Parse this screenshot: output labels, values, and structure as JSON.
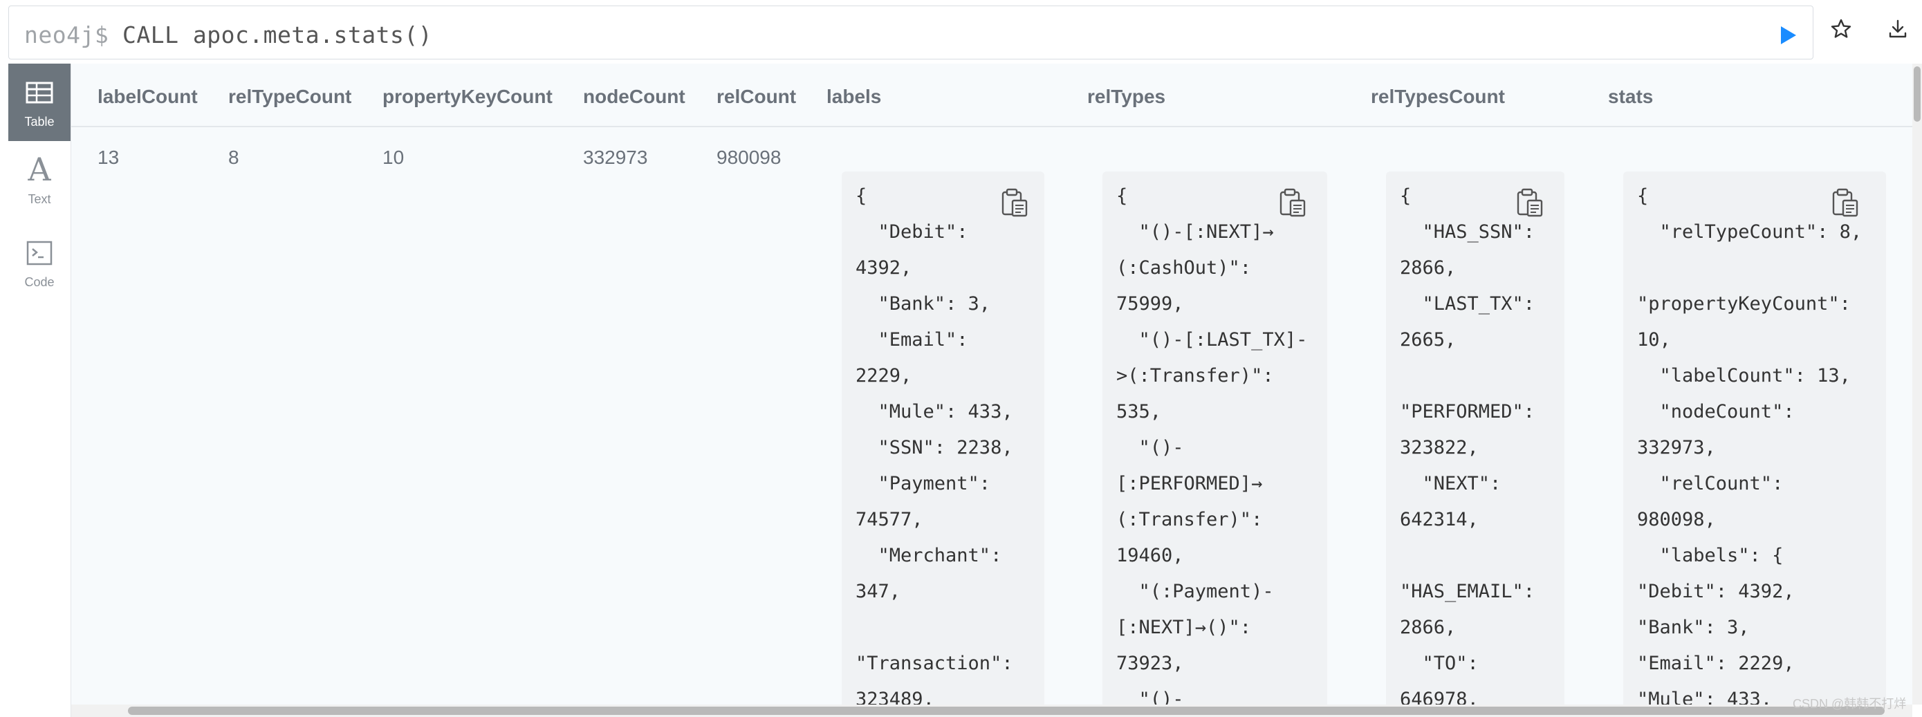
{
  "editor": {
    "prompt": "neo4j$",
    "query": "CALL apoc.meta.stats()",
    "run_icon": "play-icon",
    "favorite_icon": "star-icon",
    "download_icon": "download-icon"
  },
  "sidebar": {
    "views": [
      {
        "label": "Table",
        "icon": "table-icon",
        "active": true
      },
      {
        "label": "Text",
        "icon": "text-icon",
        "glyph": "A",
        "active": false
      },
      {
        "label": "Code",
        "icon": "code-icon",
        "active": false
      }
    ]
  },
  "table": {
    "columns": [
      "labelCount",
      "relTypeCount",
      "propertyKeyCount",
      "nodeCount",
      "relCount",
      "labels",
      "relTypes",
      "relTypesCount",
      "stats"
    ],
    "row": {
      "labelCount": "13",
      "relTypeCount": "8",
      "propertyKeyCount": "10",
      "nodeCount": "332973",
      "relCount": "980098",
      "labels": "{\n  \"Debit\":\n4392,\n  \"Bank\": 3,\n  \"Email\":\n2229,\n  \"Mule\": 433,\n  \"SSN\": 2238,\n  \"Payment\":\n74577,\n  \"Merchant\":\n347,\n\n\"Transaction\":\n323489,",
      "relTypes": "{\n  \"()-[:NEXT]→\n(:CashOut)\":\n75999,\n  \"()-[:LAST_TX]-\n>(:Transfer)\":\n535,\n  \"()-\n[:PERFORMED]→\n(:Transfer)\":\n19460,\n  \"(:Payment)-\n[:NEXT]→()\":\n73923,\n  \"()-",
      "relTypesCount": "{\n  \"HAS_SSN\":\n2866,\n  \"LAST_TX\":\n2665,\n\n\"PERFORMED\":\n323822,\n  \"NEXT\":\n642314,\n\n\"HAS_EMAIL\":\n2866,\n  \"TO\":\n646978,",
      "stats": "{\n  \"relTypeCount\": 8,\n\n\"propertyKeyCount\":\n10,\n  \"labelCount\": 13,\n  \"nodeCount\":\n332973,\n  \"relCount\":\n980098,\n  \"labels\": {\n\"Debit\": 4392,\n\"Bank\": 3,\n\"Email\": 2229,\n\"Mule\": 433,"
    },
    "copy_icon": "clipboard-icon"
  },
  "watermark": "CSDN @韩韩不打烊"
}
